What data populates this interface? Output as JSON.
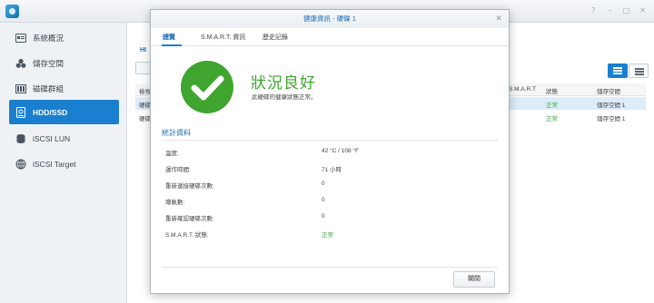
{
  "window_controls": [
    "?",
    "–",
    "□",
    "✕"
  ],
  "sidebar": {
    "items": [
      {
        "label": "系統概況",
        "icon": "overview-icon"
      },
      {
        "label": "儲存空間",
        "icon": "storage-pool-icon"
      },
      {
        "label": "磁碟群組",
        "icon": "disk-group-icon"
      },
      {
        "label": "HDD/SSD",
        "icon": "hdd-icon",
        "active": true
      },
      {
        "label": "iSCSI LUN",
        "icon": "lun-icon"
      },
      {
        "label": "iSCSI Target",
        "icon": "target-icon"
      }
    ]
  },
  "content": {
    "tab_label": "HI",
    "grid": {
      "headers": [
        "檢視",
        "S.M.A.R.T",
        "狀態",
        "儲存空間"
      ],
      "rows": [
        {
          "col0": "硬碟",
          "status": "正常",
          "volume": "儲存空間 1"
        },
        {
          "col0": "硬碟",
          "status": "正常",
          "volume": "儲存空間 1"
        }
      ]
    }
  },
  "dialog": {
    "title": "健康資訊 - 硬碟 1",
    "close_glyph": "✕",
    "tabs": [
      "總覽",
      "S.M.A.R.T. 資訊",
      "歷史記錄"
    ],
    "active_tab": 0,
    "status_title": "狀況良好",
    "status_subtitle": "此硬碟的健康狀態正常。",
    "section_title": "統計資料",
    "stats": [
      {
        "label": "溫度:",
        "value": "42 °C / 108 °F"
      },
      {
        "label": "運作時間:",
        "value": "71 小時"
      },
      {
        "label": "重新連接硬碟次數:",
        "value": "0"
      },
      {
        "label": "壞軌數:",
        "value": "0"
      },
      {
        "label": "重新確認硬碟次數:",
        "value": "0"
      },
      {
        "label": "S.M.A.R.T. 狀態:",
        "value": "正常",
        "ok": true
      }
    ],
    "close_button": "關閉"
  },
  "colors": {
    "accent": "#1a7fcf",
    "healthy_green": "#3fa52f",
    "link_blue": "#1a6fb8"
  }
}
